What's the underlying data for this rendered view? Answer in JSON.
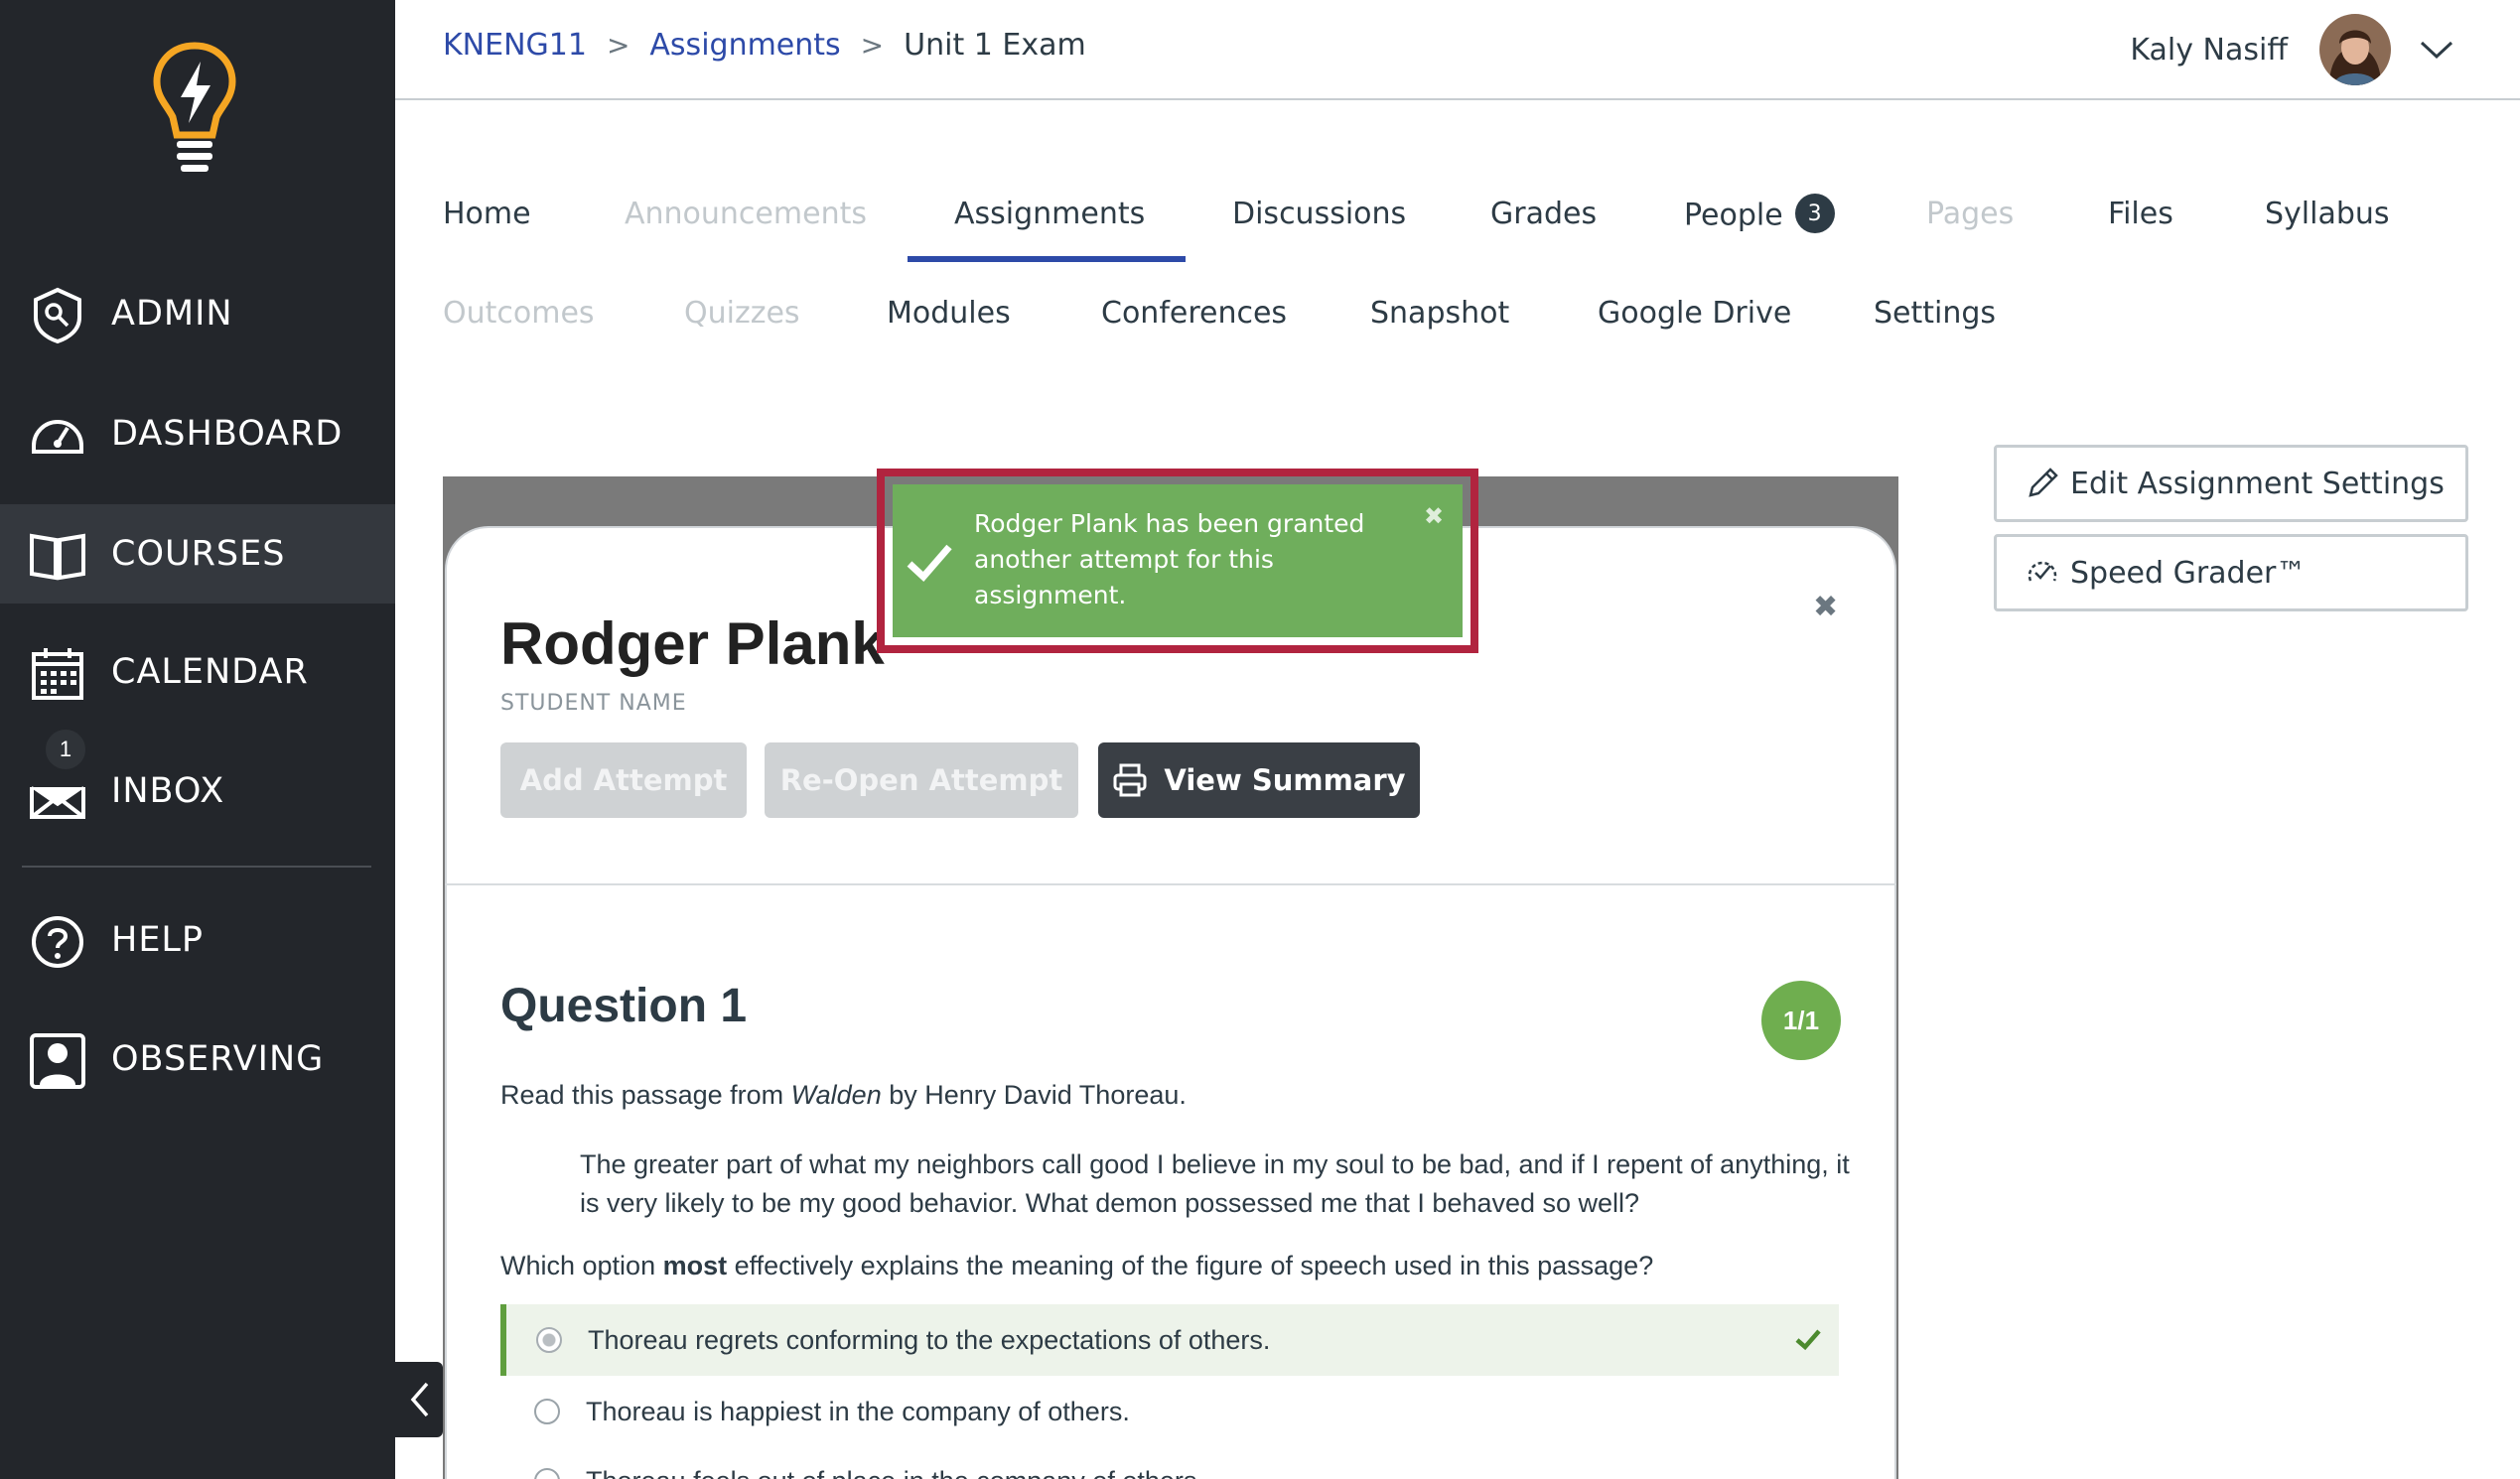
{
  "sidebar": {
    "items": [
      {
        "label": "ADMIN",
        "icon": "admin-shield-icon"
      },
      {
        "label": "DASHBOARD",
        "icon": "dashboard-gauge-icon"
      },
      {
        "label": "COURSES",
        "icon": "courses-book-icon"
      },
      {
        "label": "CALENDAR",
        "icon": "calendar-icon"
      },
      {
        "label": "INBOX",
        "icon": "inbox-icon",
        "badge": "1"
      },
      {
        "label": "HELP",
        "icon": "help-icon"
      },
      {
        "label": "OBSERVING",
        "icon": "observing-user-icon"
      }
    ],
    "active": "COURSES"
  },
  "breadcrumb": {
    "course": "KNENG11",
    "section": "Assignments",
    "current": "Unit 1 Exam"
  },
  "user": {
    "name": "Kaly Nasiff"
  },
  "course_nav": {
    "row1": [
      {
        "label": "Home",
        "disabled": false
      },
      {
        "label": "Announcements",
        "disabled": true
      },
      {
        "label": "Assignments",
        "disabled": false,
        "active": true
      },
      {
        "label": "Discussions",
        "disabled": false
      },
      {
        "label": "Grades",
        "disabled": false
      },
      {
        "label": "People",
        "disabled": false,
        "badge": "3"
      },
      {
        "label": "Pages",
        "disabled": true
      },
      {
        "label": "Files",
        "disabled": false
      },
      {
        "label": "Syllabus",
        "disabled": false
      }
    ],
    "row2": [
      {
        "label": "Outcomes",
        "disabled": true
      },
      {
        "label": "Quizzes",
        "disabled": true
      },
      {
        "label": "Modules",
        "disabled": false
      },
      {
        "label": "Conferences",
        "disabled": false
      },
      {
        "label": "Snapshot",
        "disabled": false
      },
      {
        "label": "Google Drive",
        "disabled": false
      },
      {
        "label": "Settings",
        "disabled": false
      }
    ]
  },
  "actions": {
    "edit_settings": "Edit Assignment Settings",
    "speed_grader": "Speed Grader™"
  },
  "toast": {
    "message": "Rodger Plank has been granted another attempt for this assignment.",
    "close": "✖",
    "highlight_color": "#b1243f",
    "bg_color": "#6fae5c"
  },
  "modal": {
    "student_name": "Rodger Plank",
    "student_name_label": "STUDENT NAME",
    "close": "✖",
    "buttons": {
      "add_attempt": "Add Attempt",
      "reopen_attempt": "Re-Open Attempt",
      "view_summary": "View Summary"
    },
    "question": {
      "title": "Question 1",
      "score": "1/1",
      "intro_before": "Read this passage from ",
      "intro_title": "Walden",
      "intro_after": " by Henry David Thoreau.",
      "quote": "The greater part of what my neighbors call good I believe in my soul to be bad, and if I repent of anything, it is very likely to be my good behavior. What demon possessed me that I behaved so well?",
      "prompt_before": "Which option ",
      "prompt_bold": "most",
      "prompt_after": " effectively explains the meaning of the figure of speech used in this passage?",
      "answers": [
        {
          "text": "Thoreau regrets conforming to the expectations of others.",
          "correct": true
        },
        {
          "text": "Thoreau is happiest in the company of others.",
          "correct": false
        },
        {
          "text": "Thoreau feels out of place in the company of others.",
          "correct": false
        }
      ]
    }
  },
  "colors": {
    "sidebar_bg": "#23262b",
    "accent_blue": "#2d4aa8",
    "logo_orange": "#f5a623",
    "score_green": "#6fae4f"
  }
}
